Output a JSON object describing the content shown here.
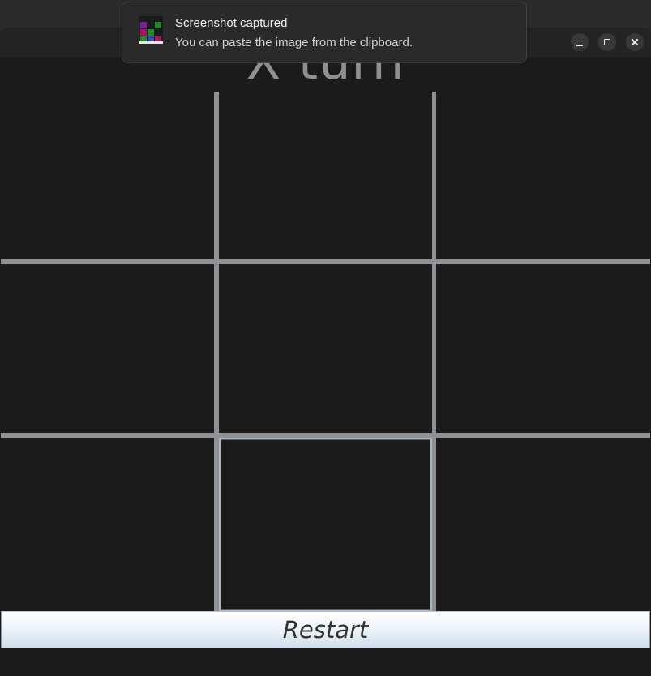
{
  "notification": {
    "title": "Screenshot captured",
    "body": "You can paste the image from the clipboard.",
    "icon": "screenshot-thumbnail-icon"
  },
  "window": {
    "controls": [
      "minimize",
      "maximize",
      "close"
    ]
  },
  "game": {
    "status": "X turn",
    "cells": [
      "",
      "",
      "",
      "",
      "",
      "",
      "",
      "",
      ""
    ],
    "focused_cell": 7,
    "restart_label": "Restart"
  },
  "colors": {
    "background": "#1b1b1c",
    "grid_lines": "#8f9194",
    "status_text": "#909090"
  }
}
